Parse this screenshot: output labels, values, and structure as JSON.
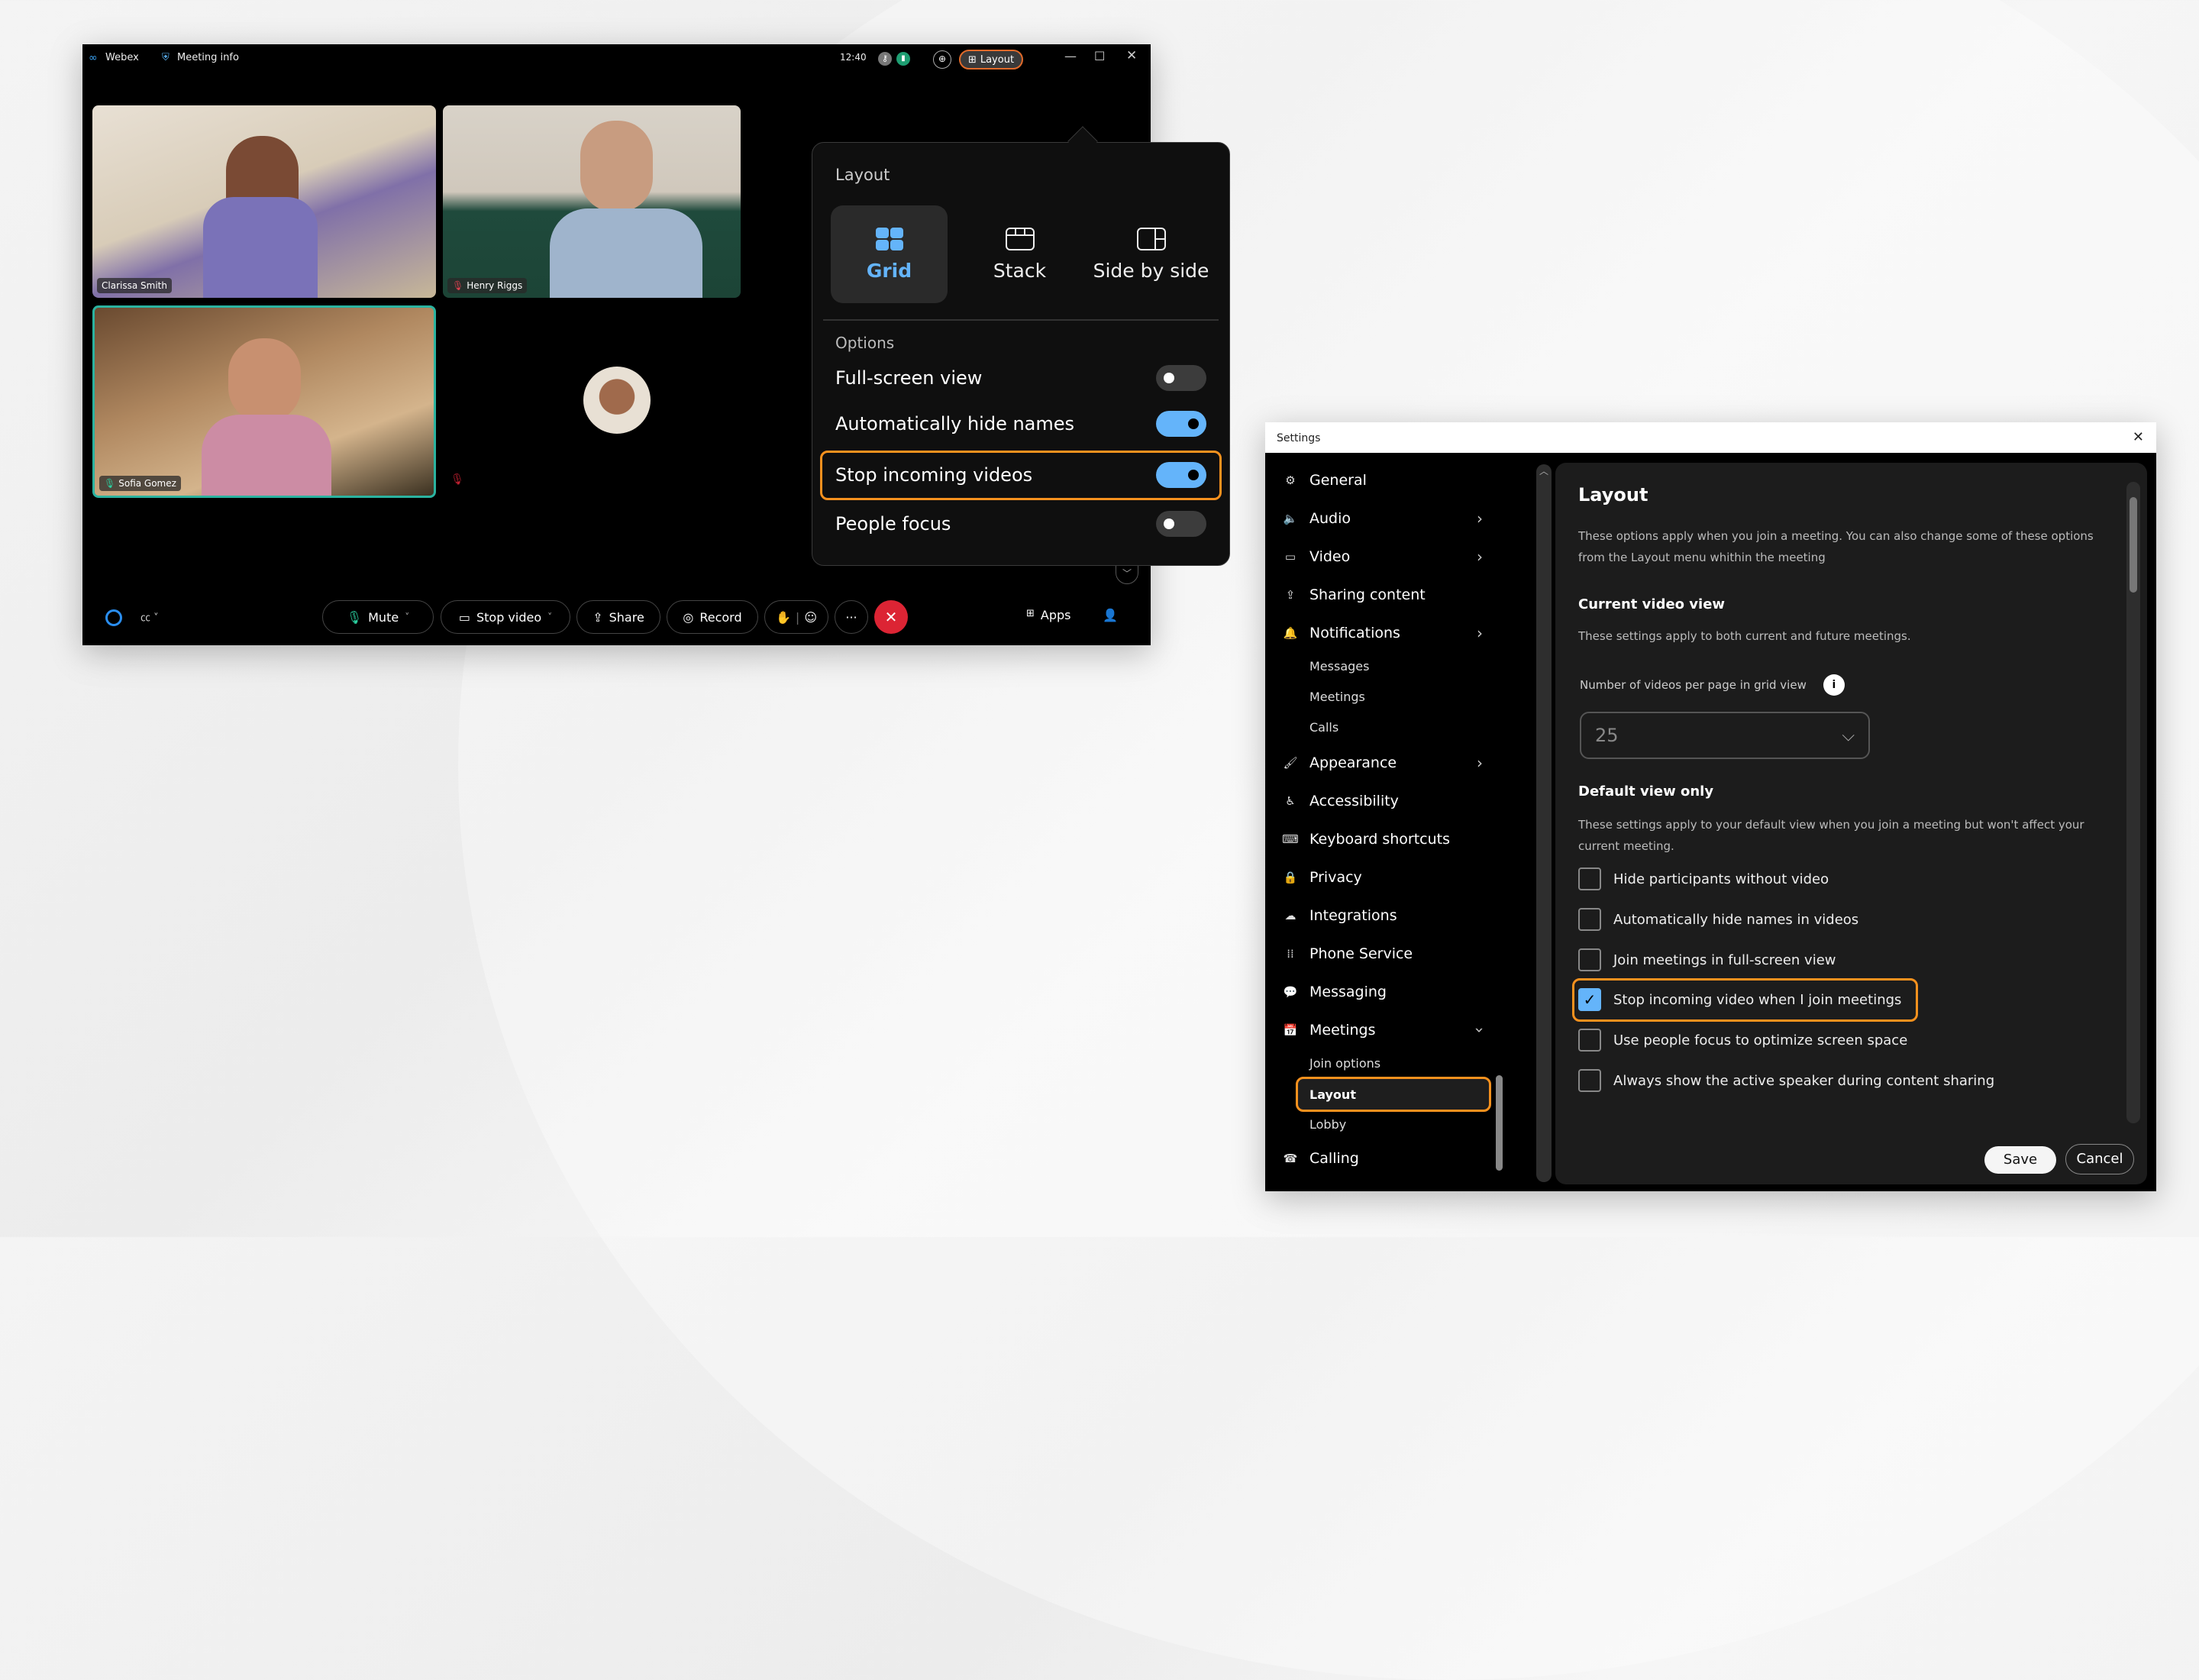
{
  "meeting": {
    "app_name": "Webex",
    "meeting_info": "Meeting info",
    "time": "12:40",
    "layout_button": "Layout",
    "participants": [
      {
        "name": "Clarissa Smith",
        "muted": false
      },
      {
        "name": "Henry Riggs",
        "muted": true
      },
      {
        "name": "Sofia Gomez",
        "muted": false,
        "active_speaker": true
      },
      {
        "name": "",
        "muted": true,
        "video_off": true
      }
    ],
    "controls": {
      "mute": "Mute",
      "stop_video": "Stop video",
      "share": "Share",
      "record": "Record",
      "more": "···",
      "apps": "Apps"
    }
  },
  "layout_menu": {
    "heading": "Layout",
    "layouts": [
      {
        "label": "Grid",
        "selected": true
      },
      {
        "label": "Stack",
        "selected": false
      },
      {
        "label": "Side by side",
        "selected": false
      }
    ],
    "options_heading": "Options",
    "options": [
      {
        "label": "Full-screen view",
        "on": false
      },
      {
        "label": "Automatically hide names",
        "on": true
      },
      {
        "label": "Stop incoming videos",
        "on": true,
        "highlighted": true
      },
      {
        "label": "People focus",
        "on": false
      }
    ]
  },
  "settings": {
    "window_title": "Settings",
    "nav": [
      {
        "label": "General",
        "icon": "gear-icon"
      },
      {
        "label": "Audio",
        "icon": "speaker-icon",
        "chevron": "right"
      },
      {
        "label": "Video",
        "icon": "camera-icon",
        "chevron": "right"
      },
      {
        "label": "Sharing content",
        "icon": "share-icon"
      },
      {
        "label": "Notifications",
        "icon": "bell-icon",
        "chevron": "right"
      },
      {
        "label": "Messages",
        "sub": true
      },
      {
        "label": "Meetings",
        "sub": true
      },
      {
        "label": "Calls",
        "sub": true
      },
      {
        "label": "Appearance",
        "icon": "brush-icon",
        "chevron": "right"
      },
      {
        "label": "Accessibility",
        "icon": "accessibility-icon"
      },
      {
        "label": "Keyboard shortcuts",
        "icon": "keyboard-icon"
      },
      {
        "label": "Privacy",
        "icon": "lock-icon"
      },
      {
        "label": "Integrations",
        "icon": "cloud-icon"
      },
      {
        "label": "Phone Service",
        "icon": "dialpad-icon"
      },
      {
        "label": "Messaging",
        "icon": "chat-icon"
      },
      {
        "label": "Meetings",
        "icon": "calendar-icon",
        "chevron": "down"
      },
      {
        "label": "Join options",
        "sub": true
      },
      {
        "label": "Layout",
        "sub": true,
        "selected": true
      },
      {
        "label": "Lobby",
        "sub": true
      },
      {
        "label": "Calling",
        "icon": "phone-icon"
      }
    ],
    "content": {
      "title": "Layout",
      "intro": "These options apply when you join a meeting. You can also change some of these options from the Layout menu whithin the meeting",
      "current_heading": "Current video view",
      "current_desc": "These settings apply to both current and future meetings.",
      "videos_label": "Number of videos per page in grid view",
      "videos_value": "25",
      "default_heading": "Default view only",
      "default_desc": "These settings apply to your default view when you join a meeting but won't affect your current meeting.",
      "checkboxes": [
        {
          "label": "Hide participants without video",
          "checked": false
        },
        {
          "label": "Automatically hide names in videos",
          "checked": false
        },
        {
          "label": "Join meetings in full-screen view",
          "checked": false
        },
        {
          "label": "Stop incoming video when I join meetings",
          "checked": true,
          "highlighted": true
        },
        {
          "label": "Use people focus to optimize screen space",
          "checked": false
        },
        {
          "label": "Always show the active speaker during content sharing",
          "checked": false
        }
      ],
      "save": "Save",
      "cancel": "Cancel"
    }
  },
  "colors": {
    "accent": "#64b4fa",
    "highlight": "#f7911e",
    "end_call": "#dc2434",
    "active_speaker": "#2bb3a0"
  }
}
